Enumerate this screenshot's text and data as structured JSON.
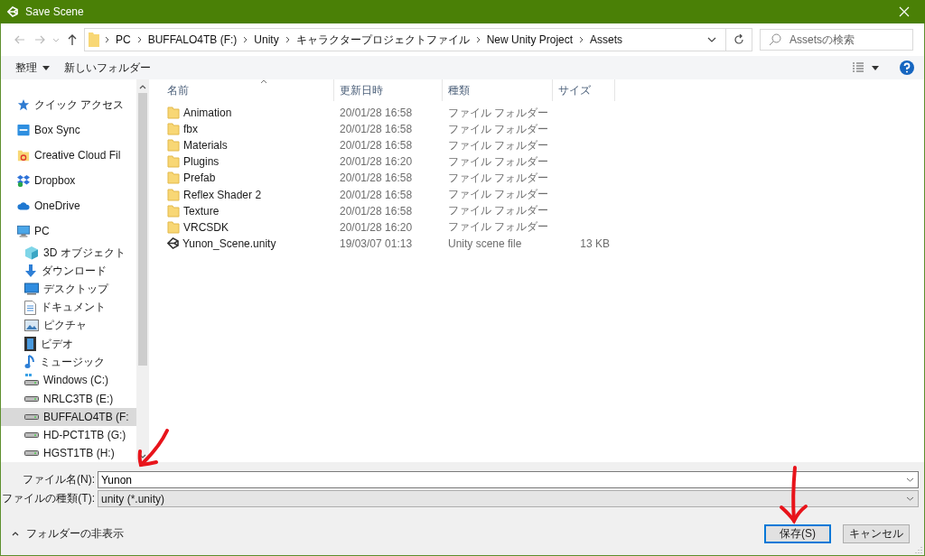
{
  "window": {
    "title": "Save Scene"
  },
  "navigation": {
    "breadcrumb": [
      "PC",
      "BUFFALO4TB (F:)",
      "Unity",
      "キャラクタープロジェクトファイル",
      "New Unity Project",
      "Assets"
    ]
  },
  "search": {
    "placeholder": "Assetsの検索"
  },
  "toolbar": {
    "organize": "整理",
    "new_folder": "新しいフォルダー"
  },
  "sidebar": {
    "items": [
      {
        "kind": "star",
        "label": "クイック アクセス",
        "selected": false
      },
      {
        "kind": "box",
        "label": "Box Sync",
        "selected": false
      },
      {
        "kind": "cc",
        "label": "Creative Cloud Fil",
        "selected": false
      },
      {
        "kind": "dropbox",
        "label": "Dropbox",
        "selected": false
      },
      {
        "kind": "onedrive",
        "label": "OneDrive",
        "selected": false
      },
      {
        "kind": "pc",
        "label": "PC",
        "selected": false,
        "children": [
          {
            "kind": "cube",
            "label": "3D オブジェクト",
            "selected": false
          },
          {
            "kind": "download",
            "label": "ダウンロード",
            "selected": false
          },
          {
            "kind": "desktop",
            "label": "デスクトップ",
            "selected": false
          },
          {
            "kind": "document",
            "label": "ドキュメント",
            "selected": false
          },
          {
            "kind": "picture",
            "label": "ピクチャ",
            "selected": false
          },
          {
            "kind": "video",
            "label": "ビデオ",
            "selected": false
          },
          {
            "kind": "music",
            "label": "ミュージック",
            "selected": false
          },
          {
            "kind": "windrive",
            "label": "Windows (C:)",
            "selected": false
          },
          {
            "kind": "drive",
            "label": "NRLC3TB (E:)",
            "selected": false
          },
          {
            "kind": "drive",
            "label": "BUFFALO4TB (F:",
            "selected": true
          },
          {
            "kind": "drive",
            "label": "HD-PCT1TB (G:)",
            "selected": false
          },
          {
            "kind": "drive",
            "label": "HGST1TB (H:)",
            "selected": false
          }
        ]
      }
    ]
  },
  "table": {
    "columns": [
      "名前",
      "更新日時",
      "種類",
      "サイズ"
    ],
    "rows": [
      {
        "kind": "folder",
        "name": "Animation",
        "date": "20/01/28 16:58",
        "type": "ファイル フォルダー"
      },
      {
        "kind": "folder",
        "name": "fbx",
        "date": "20/01/28 16:58",
        "type": "ファイル フォルダー"
      },
      {
        "kind": "folder",
        "name": "Materials",
        "date": "20/01/28 16:58",
        "type": "ファイル フォルダー"
      },
      {
        "kind": "folder",
        "name": "Plugins",
        "date": "20/01/28 16:20",
        "type": "ファイル フォルダー"
      },
      {
        "kind": "folder",
        "name": "Prefab",
        "date": "20/01/28 16:58",
        "type": "ファイル フォルダー"
      },
      {
        "kind": "folder",
        "name": "Reflex Shader 2",
        "date": "20/01/28 16:58",
        "type": "ファイル フォルダー"
      },
      {
        "kind": "folder",
        "name": "Texture",
        "date": "20/01/28 16:58",
        "type": "ファイル フォルダー"
      },
      {
        "kind": "folder",
        "name": "VRCSDK",
        "date": "20/01/28 16:20",
        "type": "ファイル フォルダー"
      },
      {
        "kind": "unity",
        "name": "Yunon_Scene.unity",
        "date": "19/03/07 01:13",
        "type": "Unity scene file",
        "size": "13 KB"
      }
    ]
  },
  "file_name": {
    "label": "ファイル名(N):",
    "value": "Yunon"
  },
  "file_type": {
    "label": "ファイルの種類(T):",
    "value": "unity (*.unity)"
  },
  "hide_folders": "フォルダーの非表示",
  "buttons": [
    {
      "label": "保存(S)",
      "default": true
    },
    {
      "label": "キャンセル",
      "default": false
    }
  ]
}
